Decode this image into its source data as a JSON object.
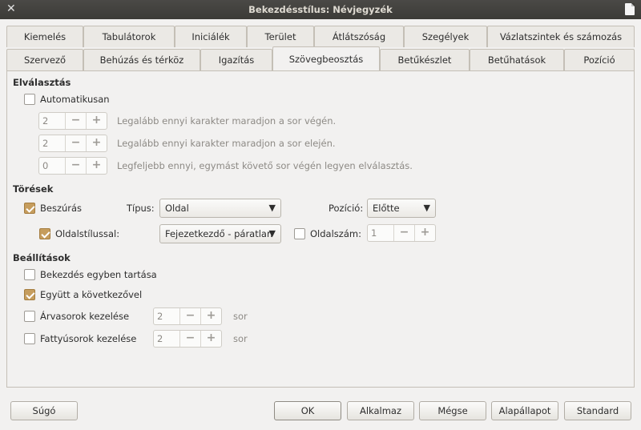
{
  "window": {
    "title": "Bekezdésstílus: Névjegyzék"
  },
  "tabs_row1": [
    "Kiemelés",
    "Tabulátorok",
    "Iniciálék",
    "Terület",
    "Átlátszóság",
    "Szegélyek",
    "Vázlatszintek és számozás"
  ],
  "tabs_row2": [
    "Szervező",
    "Behúzás és térköz",
    "Igazítás",
    "Szövegbeosztás",
    "Betűkészlet",
    "Betűhatások",
    "Pozíció"
  ],
  "active_tab": "Szövegbeosztás",
  "hyphenation": {
    "title": "Elválasztás",
    "auto_label": "Automatikusan",
    "auto_checked": false,
    "rows": [
      {
        "value": "2",
        "label": "Legalább ennyi karakter maradjon a sor végén."
      },
      {
        "value": "2",
        "label": "Legalább ennyi karakter maradjon a sor elején."
      },
      {
        "value": "0",
        "label": "Legfeljebb ennyi, egymást követő sor végén legyen elválasztás."
      }
    ]
  },
  "breaks": {
    "title": "Törések",
    "insert_label": "Beszúrás",
    "insert_checked": true,
    "type_label": "Típus:",
    "type_value": "Oldal",
    "position_label": "Pozíció:",
    "position_value": "Előtte",
    "pagestyle_label": "Oldalstílussal:",
    "pagestyle_checked": true,
    "pagestyle_value": "Fejezetkezdő - páratlan",
    "pagenum_label": "Oldalszám:",
    "pagenum_checked": false,
    "pagenum_value": "1"
  },
  "options": {
    "title": "Beállítások",
    "keep_together_label": "Bekezdés egyben tartása",
    "keep_together_checked": false,
    "keep_next_label": "Együtt a következővel",
    "keep_next_checked": true,
    "orphan_label": "Árvasorok kezelése",
    "orphan_checked": false,
    "orphan_value": "2",
    "widow_label": "Fattyúsorok kezelése",
    "widow_checked": false,
    "widow_value": "2",
    "unit": "sor"
  },
  "buttons": {
    "help": "Súgó",
    "ok": "OK",
    "apply": "Alkalmaz",
    "cancel": "Mégse",
    "reset": "Alapállapot",
    "standard": "Standard"
  },
  "colors": {
    "accent": "#c69d5d",
    "titlebar": "#3c3b37"
  }
}
